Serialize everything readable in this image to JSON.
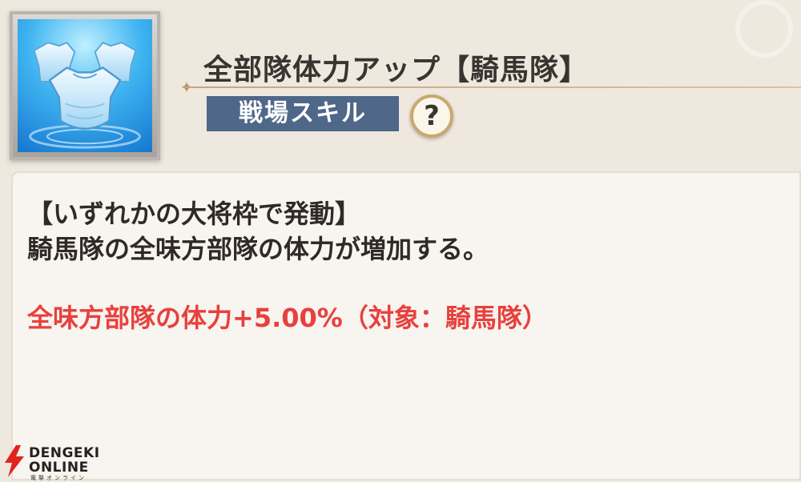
{
  "skill": {
    "icon": "armor-icon",
    "title": "全部隊体力アップ【騎馬隊】",
    "category_badge": "戦場スキル",
    "help_label": "?"
  },
  "description": {
    "condition": "【いずれかの大将枠で発動】",
    "text": "騎馬隊の全味方部隊の体力が増加する。",
    "effect": "全味方部隊の体力+5.00%（対象：騎馬隊）"
  },
  "watermark": {
    "line1": "DENGEKI",
    "line2": "ONLINE",
    "line3": "電撃オンライン"
  },
  "colors": {
    "badge_bg": "#4f6788",
    "effect_text": "#e8403e",
    "panel_bg": "#f8f4ef",
    "page_bg": "#efe8df"
  }
}
